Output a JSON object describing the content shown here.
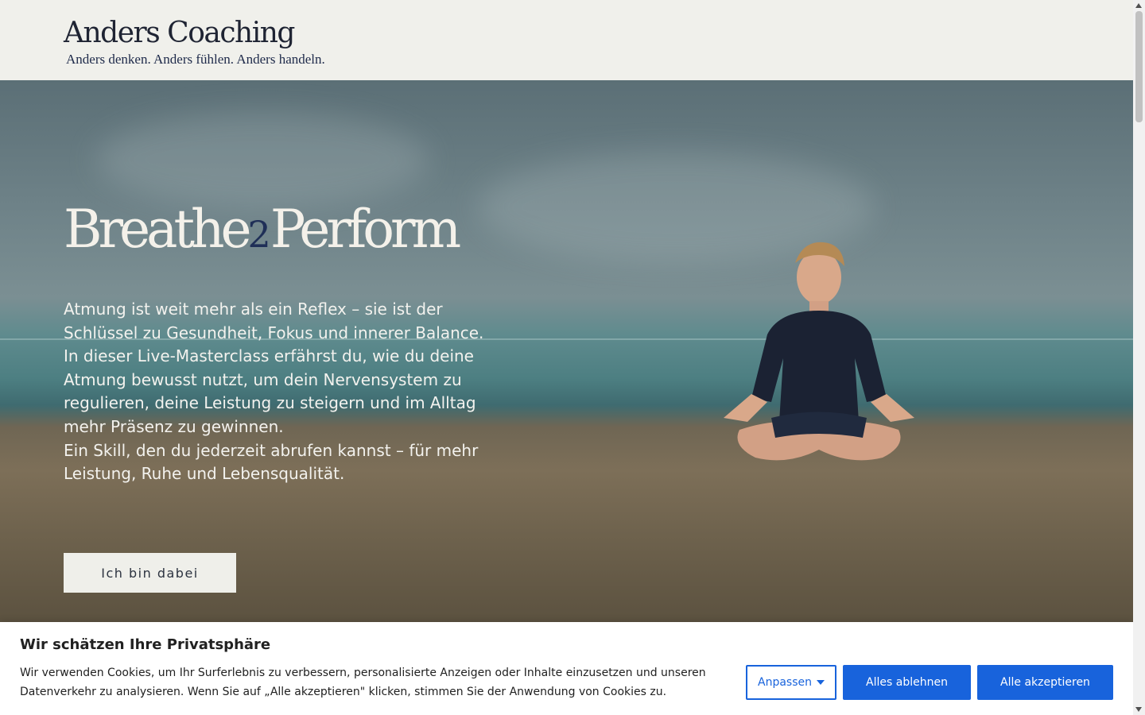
{
  "header": {
    "brand_title": "Anders Coaching",
    "tagline": "Anders denken. Anders fühlen. Anders handeln."
  },
  "hero": {
    "title_part1": "Breathe",
    "title_part2": "2",
    "title_part3": "Perform",
    "text": "Atmung ist weit mehr als ein Reflex – sie ist der Schlüssel zu Gesundheit, Fokus und innerer Balance.\nIn dieser Live-Masterclass erfährst du, wie du deine Atmung bewusst nutzt, um dein Nervensystem zu regulieren, deine Leistung zu steigern und im Alltag mehr Präsenz zu gewinnen.\nEin Skill, den du jederzeit abrufen kannst – für mehr Leistung, Ruhe und Lebensqualität.",
    "cta_label": "Ich bin dabei"
  },
  "cookie_banner": {
    "title": "Wir schätzen Ihre Privatsphäre",
    "text": "Wir verwenden Cookies, um Ihr Surferlebnis zu verbessern, personalisierte Anzeigen oder Inhalte einzusetzen und unseren Datenverkehr zu analysieren. Wenn Sie auf „Alle akzeptieren\" klicken, stimmen Sie der Anwendung von Cookies zu.",
    "customize_label": "Anpassen",
    "reject_label": "Alles ablehnen",
    "accept_label": "Alle akzeptieren"
  },
  "colors": {
    "brand_navy": "#1e2a4a",
    "cookie_button_blue": "#1863dc",
    "header_background": "#f0f0eb"
  }
}
